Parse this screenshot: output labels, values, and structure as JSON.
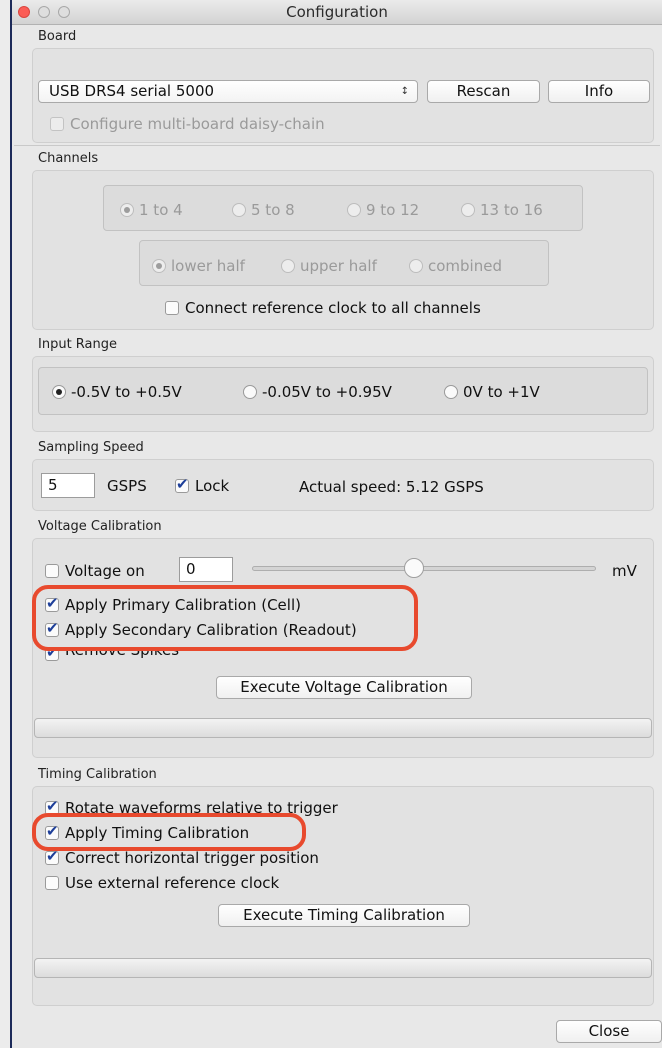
{
  "window": {
    "title": "Configuration"
  },
  "board": {
    "group_title": "Board",
    "selected": "USB DRS4 serial 5000",
    "rescan_label": "Rescan",
    "info_label": "Info",
    "daisy_chain_label": "Configure multi-board daisy-chain",
    "daisy_chain_checked": false
  },
  "channels": {
    "group_title": "Channels",
    "options": [
      "1 to 4",
      "5 to 8",
      "9 to 12",
      "13 to 16"
    ],
    "selected": "1 to 4",
    "half_options": [
      "lower half",
      "upper half",
      "combined"
    ],
    "half_selected": "lower half",
    "ref_clock_label": "Connect reference clock to all channels",
    "ref_clock_checked": false
  },
  "input_range": {
    "group_title": "Input Range",
    "options": [
      "-0.5V to +0.5V",
      "-0.05V to +0.95V",
      "0V to +1V"
    ],
    "selected": "-0.5V to +0.5V"
  },
  "sampling": {
    "group_title": "Sampling Speed",
    "value": "5",
    "unit": "GSPS",
    "lock_label": "Lock",
    "lock_checked": true,
    "actual_label": "Actual speed:",
    "actual_value": "5.12 GSPS"
  },
  "voltage_cal": {
    "group_title": "Voltage Calibration",
    "voltage_on_label": "Voltage on",
    "voltage_on_checked": false,
    "voltage_value": "0",
    "unit": "mV",
    "slider_level": 0.47,
    "primary_label": "Apply Primary Calibration (Cell)",
    "secondary_label": "Apply Secondary Calibration (Readout)",
    "spikes_label": "Remove Spikes",
    "execute_label": "Execute Voltage Calibration",
    "progress": 0
  },
  "timing_cal": {
    "group_title": "Timing Calibration",
    "rotate_label": "Rotate waveforms relative to trigger",
    "apply_label": "Apply Timing Calibration",
    "correct_label": "Correct horizontal trigger position",
    "external_label": "Use external reference clock",
    "external_checked": false,
    "execute_label": "Execute Timing Calibration",
    "progress": 0
  },
  "footer": {
    "close_label": "Close"
  },
  "colors": {
    "highlight": "#e84a2e",
    "check": "#1e3f99"
  }
}
